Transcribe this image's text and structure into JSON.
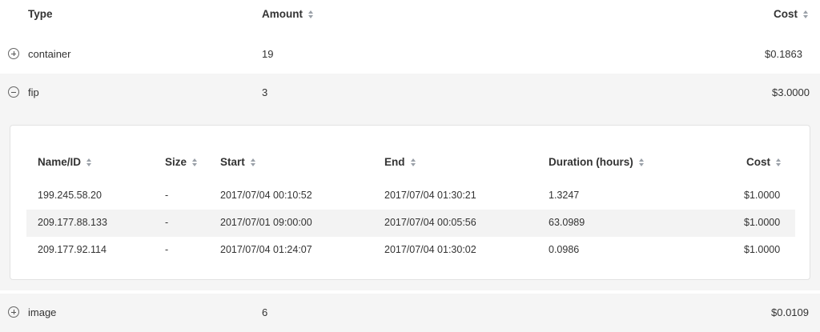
{
  "table": {
    "columns": {
      "type": "Type",
      "amount": "Amount",
      "cost": "Cost"
    },
    "rows": [
      {
        "type": "container",
        "amount": "19",
        "cost": "$0.1863",
        "expanded": false
      },
      {
        "type": "fip",
        "amount": "3",
        "cost": "$3.0000",
        "expanded": true
      },
      {
        "type": "image",
        "amount": "6",
        "cost": "$0.0109",
        "expanded": false
      }
    ]
  },
  "detail": {
    "columns": {
      "name": "Name/ID",
      "size": "Size",
      "start": "Start",
      "end": "End",
      "duration": "Duration (hours)",
      "cost": "Cost"
    },
    "rows": [
      {
        "name": "199.245.58.20",
        "size": "-",
        "start": "2017/07/04 00:10:52",
        "end": "2017/07/04 01:30:21",
        "duration": "1.3247",
        "cost": "$1.0000"
      },
      {
        "name": "209.177.88.133",
        "size": "-",
        "start": "2017/07/01 09:00:00",
        "end": "2017/07/04 00:05:56",
        "duration": "63.0989",
        "cost": "$1.0000"
      },
      {
        "name": "209.177.92.114",
        "size": "-",
        "start": "2017/07/04 01:24:07",
        "end": "2017/07/04 01:30:02",
        "duration": "0.0986",
        "cost": "$1.0000"
      }
    ]
  },
  "icons": {
    "expand": "plus-circle-icon",
    "collapse": "minus-circle-icon",
    "sort": "sort-icon"
  }
}
